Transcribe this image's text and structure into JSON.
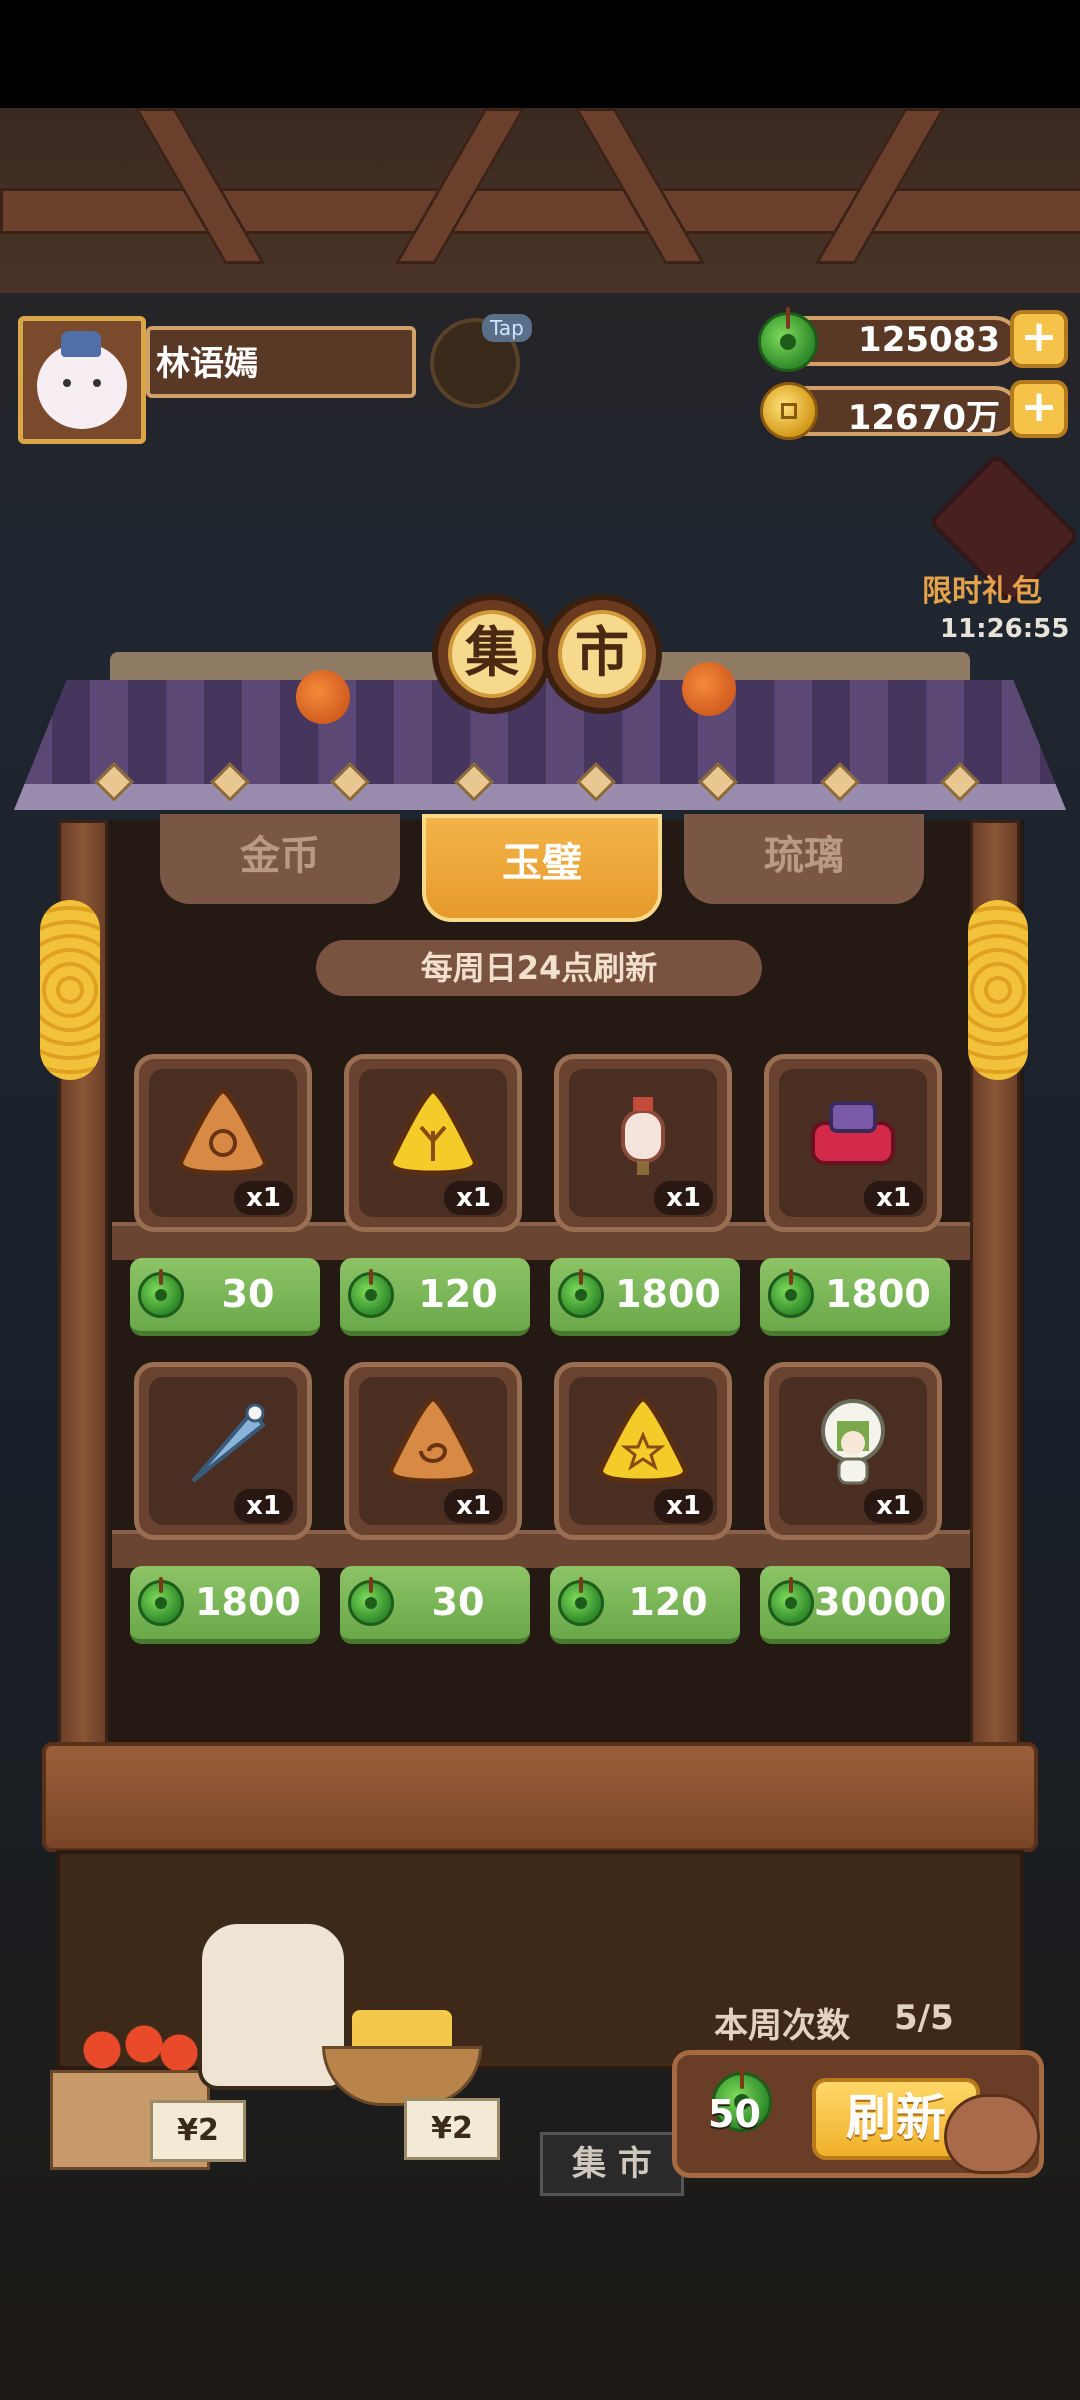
{
  "player": {
    "name": "林语嫣",
    "tap_label": "Tap"
  },
  "currency": {
    "jade": "125083",
    "coins": "12670万",
    "plus_symbol": "+"
  },
  "limited_pack": {
    "label": "限时礼包",
    "timer": "11:26:55"
  },
  "shop": {
    "title_chars": [
      "集",
      "市"
    ],
    "tabs": [
      {
        "label": "金币",
        "active": false
      },
      {
        "label": "玉璧",
        "active": true
      },
      {
        "label": "琉璃",
        "active": false
      }
    ],
    "refresh_notice": "每周日24点刷新",
    "items": [
      {
        "icon": "sun-triangle-cake-icon",
        "qty": "x1",
        "price": "30"
      },
      {
        "icon": "antler-triangle-cake-icon",
        "qty": "x1",
        "price": "120"
      },
      {
        "icon": "lantern-icon",
        "qty": "x1",
        "price": "1800"
      },
      {
        "icon": "red-stamp-box-icon",
        "qty": "x1",
        "price": "1800"
      },
      {
        "icon": "paper-fan-icon",
        "qty": "x1",
        "price": "1800"
      },
      {
        "icon": "spiral-triangle-cake-icon",
        "qty": "x1",
        "price": "30"
      },
      {
        "icon": "star-triangle-cake-icon",
        "qty": "x1",
        "price": "120"
      },
      {
        "icon": "green-hair-doll-icon",
        "qty": "x1",
        "price": "30000"
      }
    ]
  },
  "weekly": {
    "label": "本周次数",
    "count": "5/5"
  },
  "refresh": {
    "cost": "50",
    "label": "刷新"
  },
  "decor": {
    "price_tag_left": "¥2",
    "price_tag_right": "¥2",
    "market_sign": "集 市"
  },
  "colors": {
    "jade_green": "#6aa84a",
    "gold": "#f5c24a",
    "roof_purple": "#5b4874"
  }
}
